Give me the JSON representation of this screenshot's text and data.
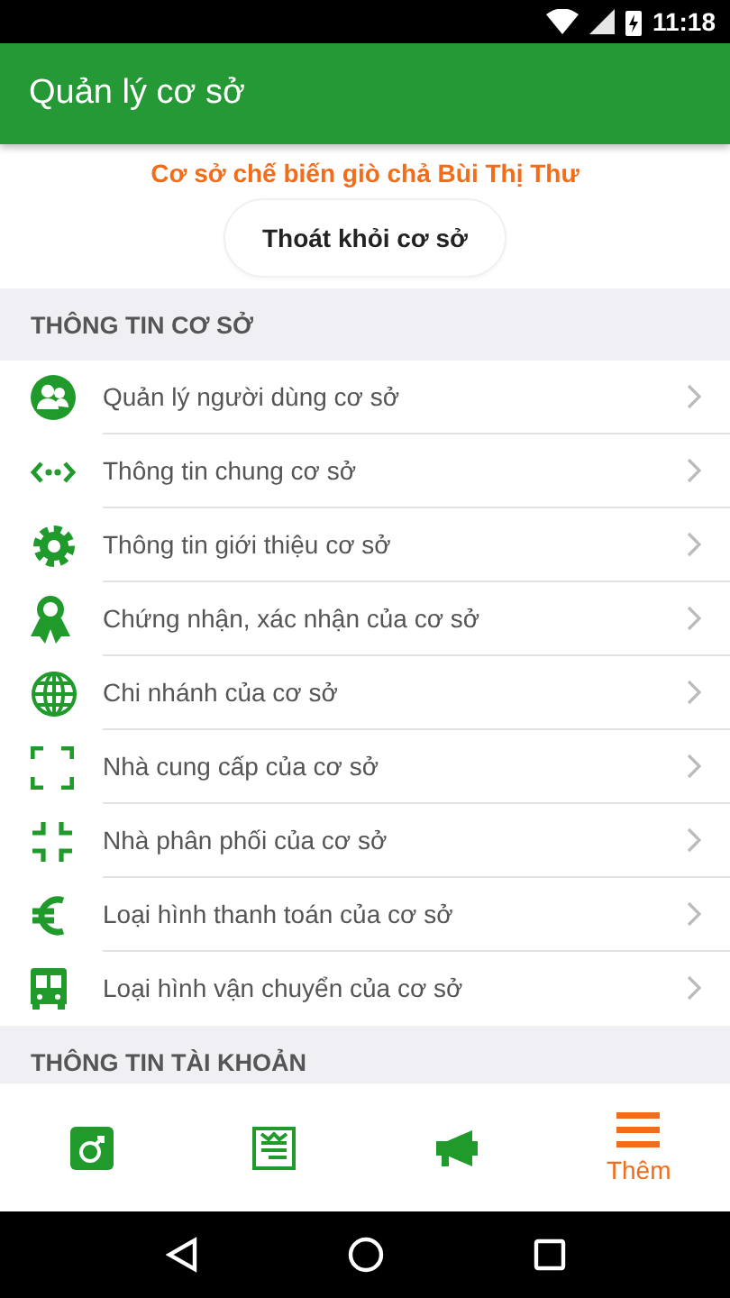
{
  "status_bar": {
    "time": "11:18"
  },
  "app_bar": {
    "title": "Quản lý cơ sở"
  },
  "facility": {
    "name": "Cơ sở chế biến giò chả Bùi Thị Thư",
    "leave_button": "Thoát khỏi cơ sở"
  },
  "sections": [
    {
      "title": "THÔNG TIN CƠ SỞ",
      "items": [
        {
          "kind": "users",
          "label": "Quản lý người dùng cơ sở"
        },
        {
          "kind": "code",
          "label": "Thông tin chung cơ sở"
        },
        {
          "kind": "gear",
          "label": "Thông tin giới thiệu cơ sở"
        },
        {
          "kind": "award",
          "label": "Chứng nhận, xác nhận của cơ sở"
        },
        {
          "kind": "globe",
          "label": "Chi nhánh của cơ sở"
        },
        {
          "kind": "expand",
          "label": "Nhà cung cấp của cơ sở"
        },
        {
          "kind": "shrink",
          "label": "Nhà phân phối của cơ sở"
        },
        {
          "kind": "euro",
          "label": "Loại hình thanh toán của cơ sở"
        },
        {
          "kind": "bus",
          "label": "Loại hình vận chuyển của cơ sở"
        }
      ]
    },
    {
      "title": "THÔNG TIN TÀI KHOẢN"
    }
  ],
  "bottom_nav": [
    {
      "kind": "app",
      "selected": false
    },
    {
      "kind": "list",
      "selected": false
    },
    {
      "kind": "megaphone",
      "selected": false
    },
    {
      "kind": "menu",
      "selected": true,
      "label": "Thêm"
    }
  ]
}
